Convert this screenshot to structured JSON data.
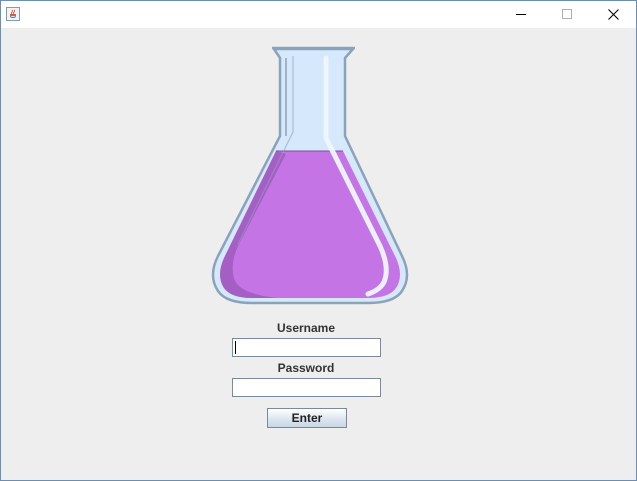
{
  "window": {
    "controls": {
      "minimize": "minimize",
      "maximize": "maximize",
      "close": "close"
    }
  },
  "form": {
    "username_label": "Username",
    "username_value": "",
    "password_label": "Password",
    "password_value": "",
    "enter_label": "Enter"
  },
  "icons": {
    "app": "java-coffee-cup-icon",
    "flask": "erlenmeyer-flask-icon"
  },
  "colors": {
    "liquid": "#c574e6",
    "liquid_shadow": "#9a58b8",
    "glass": "#d6e8fb",
    "glass_border": "#8aa3bb",
    "background": "#eeeeee"
  }
}
